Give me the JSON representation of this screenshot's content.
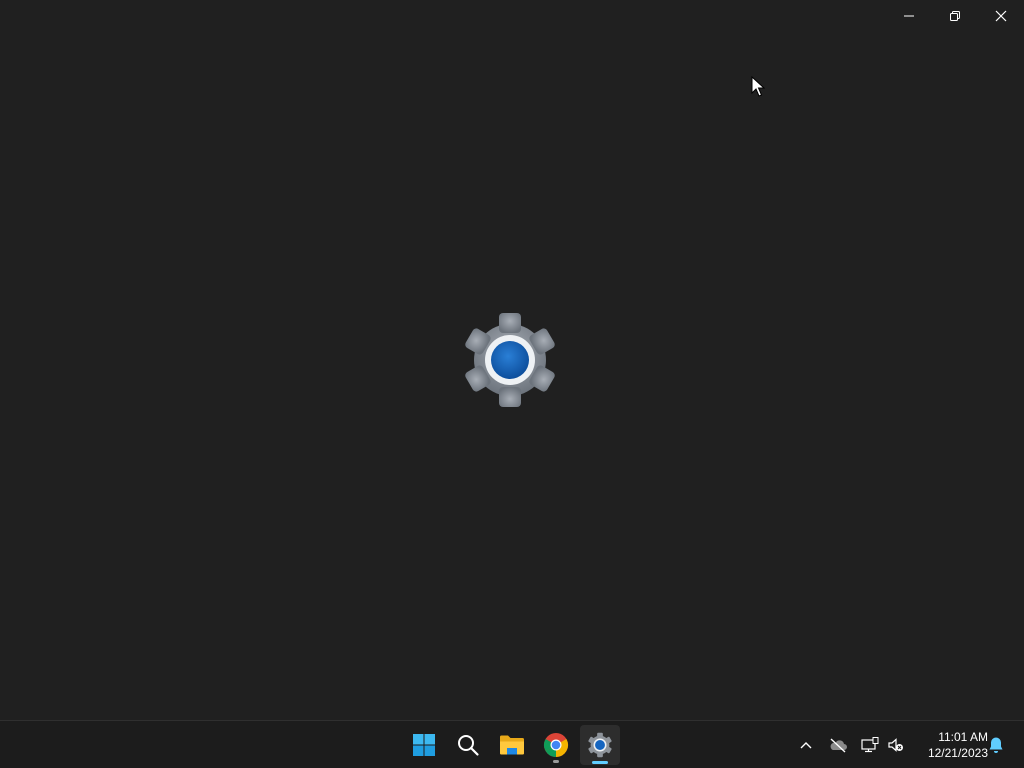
{
  "window": {
    "caption_buttons": [
      {
        "name": "minimize",
        "icon": "minimize-icon"
      },
      {
        "name": "restore",
        "icon": "restore-icon"
      },
      {
        "name": "close",
        "icon": "close-icon"
      }
    ],
    "splash_icon": "settings-gear-icon"
  },
  "taskbar": {
    "apps": [
      {
        "name": "start",
        "icon": "windows-logo-icon"
      },
      {
        "name": "search",
        "icon": "search-icon"
      },
      {
        "name": "file-explorer",
        "icon": "folder-icon",
        "running": false
      },
      {
        "name": "chrome",
        "icon": "chrome-icon",
        "running": true
      },
      {
        "name": "settings",
        "icon": "settings-gear-icon",
        "running": true,
        "active": true
      }
    ],
    "tray": {
      "icons": [
        "chevron-up-icon",
        "onedrive-offline-icon",
        "network-icon",
        "volume-muted-icon",
        "notification-bell-icon"
      ]
    },
    "clock": {
      "time": "11:01 AM",
      "date": "12/21/2023"
    }
  },
  "colors": {
    "background": "#202020",
    "taskbar": "#1c1c1c",
    "accent": "#60cdff",
    "gear_blue": "#1565c0"
  }
}
